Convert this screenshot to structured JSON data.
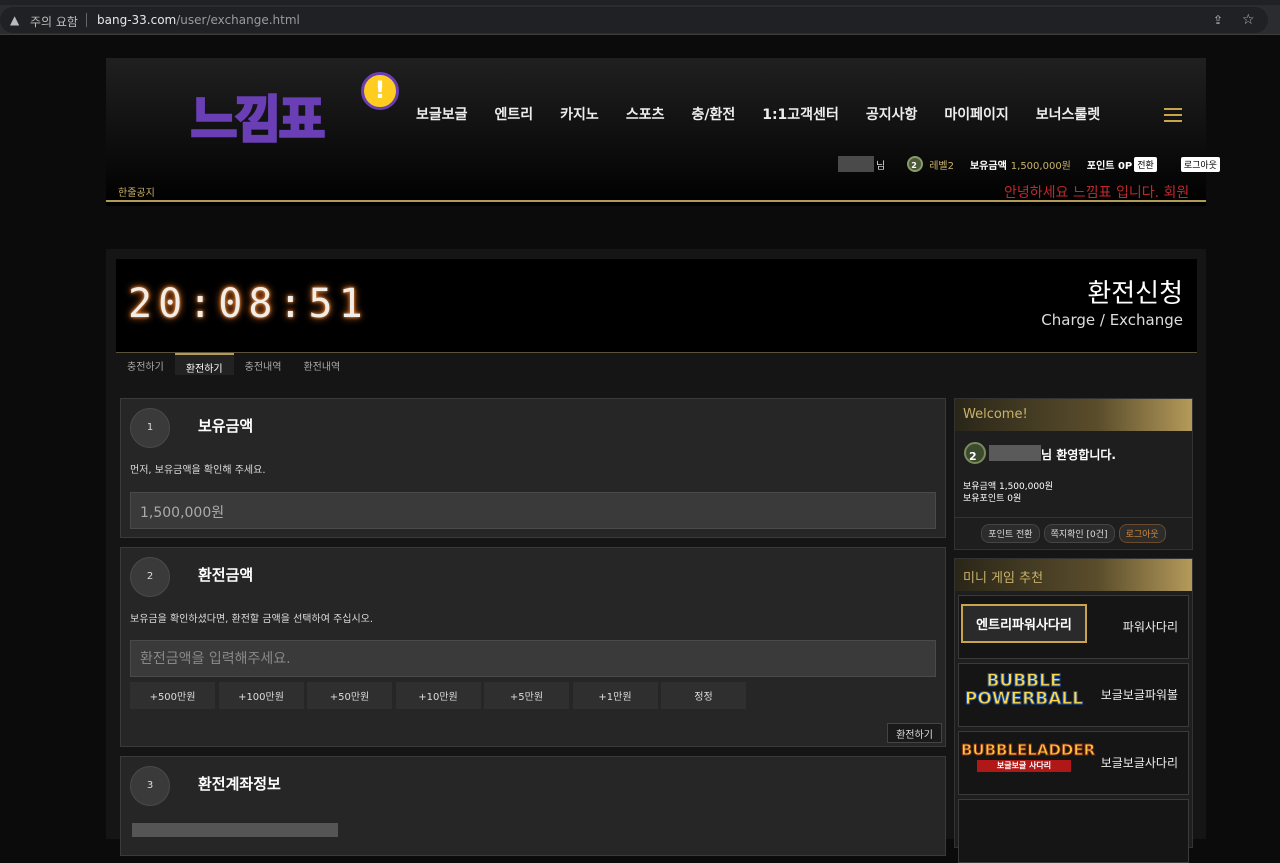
{
  "browser": {
    "security_warning": "주의 요함",
    "url_host": "bang-33.com",
    "url_path": "/user/exchange.html"
  },
  "header": {
    "logo_text": "느낌표",
    "logo_mark": "!",
    "nav": [
      "보글보글",
      "엔트리",
      "카지노",
      "스포츠",
      "충/환전",
      "1:1고객센터",
      "공지사항",
      "마이페이지",
      "보너스룰렛"
    ],
    "user": {
      "name_suffix": "님",
      "level": "레벨2",
      "money_label": "보유금액",
      "money_value": "1,500,000원",
      "point_label": "포인트 0P",
      "convert_btn": "전환",
      "logout_btn": "로그아웃"
    },
    "notice_label": "한줄공지",
    "notice_marquee": "안녕하세요 느낌표 입니다. 회원"
  },
  "banner": {
    "clock": "20:08:51",
    "title": "환전신청",
    "subtitle": "Charge / Exchange"
  },
  "tabs": [
    "충전하기",
    "환전하기",
    "충전내역",
    "환전내역"
  ],
  "section1": {
    "num": "1",
    "title": "보유금액",
    "desc": "먼저, 보유금액을 확인해 주세요.",
    "value": "1,500,000원"
  },
  "section2": {
    "num": "2",
    "title": "환전금액",
    "desc": "보유금을 확인하셨다면, 환전할 금액을 선택하여 주십시오.",
    "placeholder": "환전금액을 입력해주세요.",
    "amounts": [
      "+500만원",
      "+100만원",
      "+50만원",
      "+10만원",
      "+5만원",
      "+1만원",
      "정정"
    ],
    "submit": "환전하기"
  },
  "section3": {
    "num": "3",
    "title": "환전계좌정보"
  },
  "welcome": {
    "head": "Welcome!",
    "greeting": "님 환영합니다.",
    "money": "보유금액 1,500,000원",
    "point": "보유포인트 0원",
    "btn_point": "포인트 전환",
    "btn_msg": "쪽지확인 [0건]",
    "btn_logout": "로그아웃"
  },
  "games": {
    "head": "미니 게임 추천",
    "items": [
      {
        "logo": "엔트리파워사다리",
        "name": "파워사다리"
      },
      {
        "logo": "BUBBLE POWERBALL",
        "name": "보글보글파워볼"
      },
      {
        "logo": "BUBBLELADDER",
        "logo_sub": "보글보글 사다리",
        "name": "보글보글사다리"
      }
    ]
  },
  "colors": {
    "accent_gold": "#b29a58",
    "notice_red": "#c0282d",
    "logo_yellow": "#ffd42a",
    "logo_purple": "#6a3fb5"
  }
}
